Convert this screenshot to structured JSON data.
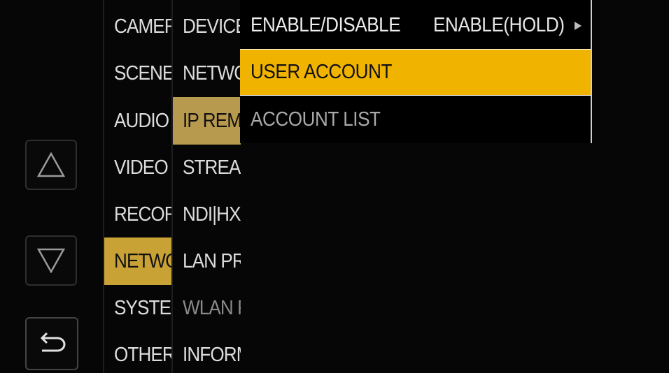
{
  "nav_buttons": {
    "up_icon": "up-triangle-icon",
    "down_icon": "down-triangle-icon",
    "back_icon": "return-arrow-icon"
  },
  "column1": {
    "items": [
      "CAMERA",
      "SCENE",
      "AUDIO",
      "VIDEO OUT",
      "RECORDING",
      "NETWORK",
      "SYSTEM",
      "OTHERS"
    ],
    "selected_index": 5
  },
  "column2": {
    "items": [
      "DEVICE SEL",
      "NETWORK FUNC",
      "IP REMOTE",
      "STREAMING",
      "NDI|HX",
      "LAN PROPERTY",
      "WLAN PROPERTY",
      "INFORMATION"
    ],
    "selected_index": 2
  },
  "column3": {
    "enable_label": "ENABLE/DISABLE",
    "enable_value": "ENABLE(HOLD)",
    "user_account": "USER ACCOUNT",
    "account_list": "ACCOUNT LIST"
  },
  "colors": {
    "selected_highlight": "#f0b400",
    "column_highlight": "#c9a236"
  }
}
